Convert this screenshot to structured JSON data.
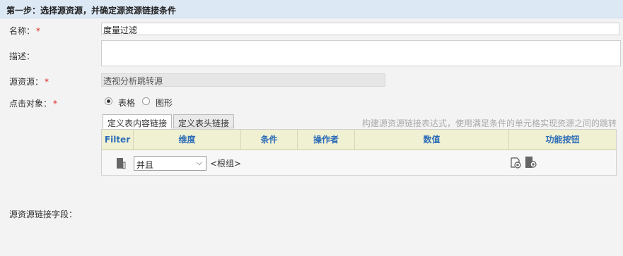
{
  "step": {
    "title": "第一步：选择源资源，并确定源资源链接条件"
  },
  "form": {
    "name_label": "名称：",
    "name_value": "度量过滤",
    "desc_label": "描述：",
    "source_label": "源资源：",
    "source_value": "透视分析跳转源",
    "click_label": "点击对象：",
    "required_mark": "*",
    "radio_table_label": "表格",
    "radio_chart_label": "图形",
    "radio_selected": "表格",
    "link_field_label": "源资源链接字段："
  },
  "tabs": [
    {
      "label": "定义表内容链接",
      "active": true
    },
    {
      "label": "定义表头链接",
      "active": false
    }
  ],
  "hint": "构建源资源链接表达式，使用满足条件的单元格实现资源之间的跳转",
  "grid": {
    "headers": [
      "Filter",
      "维度",
      "条件",
      "操作者",
      "数值",
      "功能按钮"
    ],
    "row": {
      "operator_value": "并且",
      "root_label": "<根组>"
    }
  },
  "icons": {
    "filter_icon": "filter-node-icon",
    "action_icons": [
      "add-condition-icon",
      "add-group-icon"
    ],
    "select_arrow": "chevron-down-icon"
  }
}
